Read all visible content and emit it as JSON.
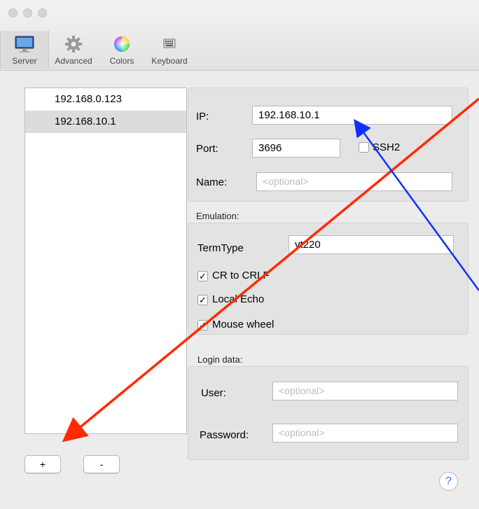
{
  "toolbar": {
    "tabs": [
      {
        "label": "Server",
        "icon": "monitor-icon"
      },
      {
        "label": "Advanced",
        "icon": "gear-icon"
      },
      {
        "label": "Colors",
        "icon": "color-wheel-icon"
      },
      {
        "label": "Keyboard",
        "icon": "keyboard-icon"
      }
    ],
    "selected": "Server"
  },
  "servers": [
    "192.168.0.123",
    "192.168.10.1"
  ],
  "list_buttons": {
    "add": "+",
    "remove": "-"
  },
  "connection": {
    "ip_label": "IP:",
    "ip_value": "192.168.10.1",
    "port_label": "Port:",
    "port_value": "3696",
    "ssh2_label": "SSH2",
    "ssh2_checked": false,
    "name_label": "Name:",
    "name_placeholder": "<optional>"
  },
  "emulation": {
    "section_label": "Emulation:",
    "termtype_label": "TermType",
    "termtype_value": "vt220",
    "cr_to_crlf_label": "CR to CRLF",
    "cr_to_crlf_checked": true,
    "local_echo_label": "Local Echo",
    "local_echo_checked": true,
    "mouse_wheel_label": "Mouse wheel",
    "mouse_wheel_checked": true
  },
  "login": {
    "section_label": "Login data:",
    "user_label": "User:",
    "user_placeholder": "<optional>",
    "password_label": "Password:",
    "password_placeholder": "<optional>"
  },
  "help_label": "?",
  "check_glyph": "✓",
  "colors": {
    "annotation_red": "#ff2a00",
    "annotation_blue": "#1030ff",
    "selection_gray": "#dcdcdc",
    "help_blue": "#2f7bf5"
  }
}
